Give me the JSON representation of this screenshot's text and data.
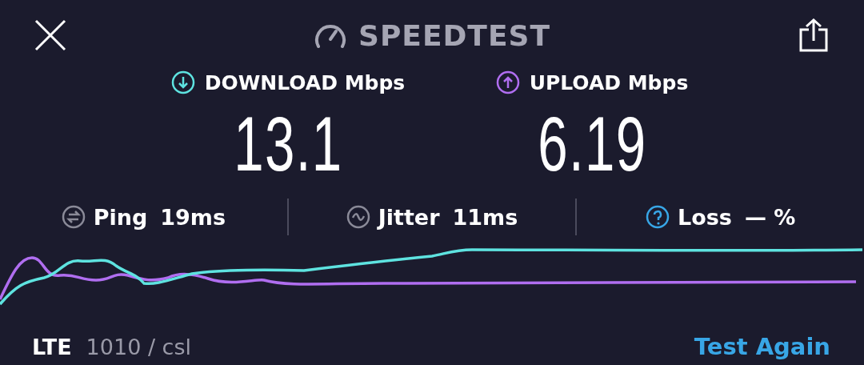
{
  "header": {
    "title": "SPEEDTEST"
  },
  "results": [
    {
      "kind": "download",
      "label": "DOWNLOAD Mbps",
      "value": "13.1"
    },
    {
      "kind": "upload",
      "label": "UPLOAD Mbps",
      "value": "6.19"
    }
  ],
  "stats": [
    {
      "kind": "ping",
      "label": "Ping",
      "value": "19ms"
    },
    {
      "kind": "jitter",
      "label": "Jitter",
      "value": "11ms"
    },
    {
      "kind": "loss",
      "label": "Loss",
      "value": "—",
      "unit": "%"
    }
  ],
  "footer": {
    "network": "LTE",
    "provider": "1010 / csl",
    "action": "Test Again"
  }
}
